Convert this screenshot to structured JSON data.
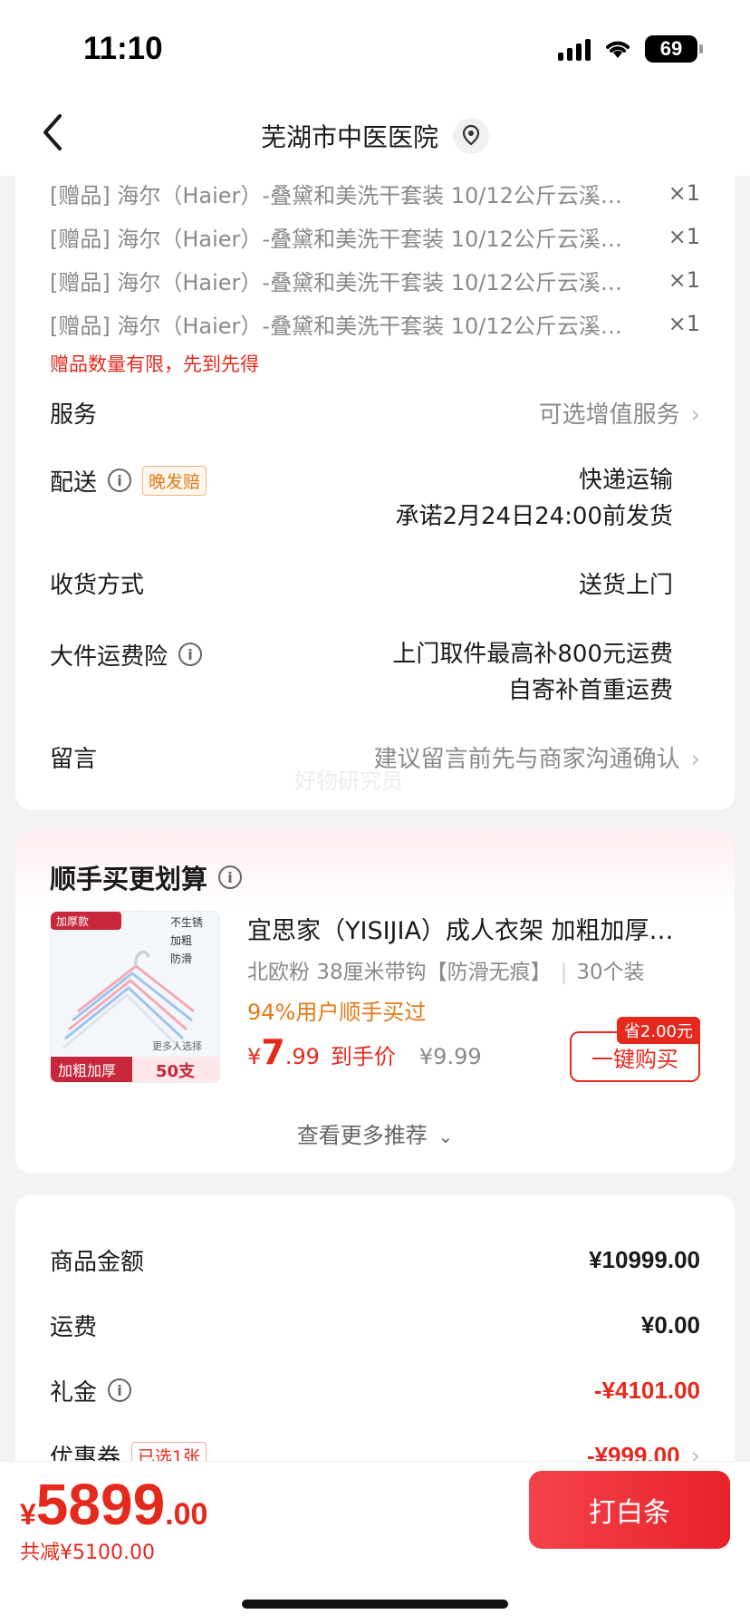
{
  "status_bar": {
    "time": "11:10",
    "battery": "69"
  },
  "nav": {
    "title": "芜湖市中医医院"
  },
  "gifts": [
    {
      "text": "[赠品] 海尔（Haier）-叠黛和美洗干套装 10/12公斤云溪…",
      "qty": "×1"
    },
    {
      "text": "[赠品] 海尔（Haier）-叠黛和美洗干套装 10/12公斤云溪…",
      "qty": "×1"
    },
    {
      "text": "[赠品] 海尔（Haier）-叠黛和美洗干套装 10/12公斤云溪…",
      "qty": "×1"
    },
    {
      "text": "[赠品] 海尔（Haier）-叠黛和美洗干套装 10/12公斤云溪…",
      "qty": "×1"
    }
  ],
  "gift_note": "赠品数量有限，先到先得",
  "service": {
    "label": "服务",
    "value": "可选增值服务"
  },
  "delivery": {
    "label": "配送",
    "tag": "晚发赔",
    "value_line1": "快递运输",
    "value_line2": "承诺2月24日24:00前发货"
  },
  "receive": {
    "label": "收货方式",
    "value": "送货上门"
  },
  "insurance": {
    "label": "大件运费险",
    "value_line1": "上门取件最高补800元运费",
    "value_line2": "自寄补首重运费"
  },
  "message": {
    "label": "留言",
    "value": "建议留言前先与商家沟通确认"
  },
  "watermark": "好物研究员",
  "recommend": {
    "title": "顺手买更划算",
    "product": {
      "title": "宜思家（YISIJIA）成人衣架 加粗加厚…",
      "sub_spec": "北欧粉 38厘米带钩【防滑无痕】",
      "sub_qty": "30个装",
      "hot": "94%用户顺手买过",
      "price_symbol": "¥",
      "price_int": "7",
      "price_dec": ".99",
      "price_tag": "到手价",
      "price_orig": "¥9.99",
      "save_badge": "省2.00元",
      "buy_label": "一键购买",
      "img_badge": "加厚款",
      "img_features": [
        "不生锈",
        "加粗",
        "防滑"
      ],
      "img_caption": "更多人选择",
      "img_bottom_left": "加粗加厚",
      "img_bottom_right": "50支"
    },
    "more": "查看更多推荐"
  },
  "summary": {
    "goods": {
      "label": "商品金额",
      "value": "¥10999.00"
    },
    "shipping": {
      "label": "运费",
      "value": "¥0.00"
    },
    "gift_money": {
      "label": "礼金",
      "value": "-¥4101.00"
    },
    "coupon": {
      "label": "优惠券",
      "tag": "已选1张",
      "value": "-¥999.00"
    }
  },
  "bottom": {
    "total_symbol": "¥",
    "total_int": "5899",
    "total_dec": ".00",
    "saved": "共减¥5100.00",
    "pay_label": "打白条"
  }
}
